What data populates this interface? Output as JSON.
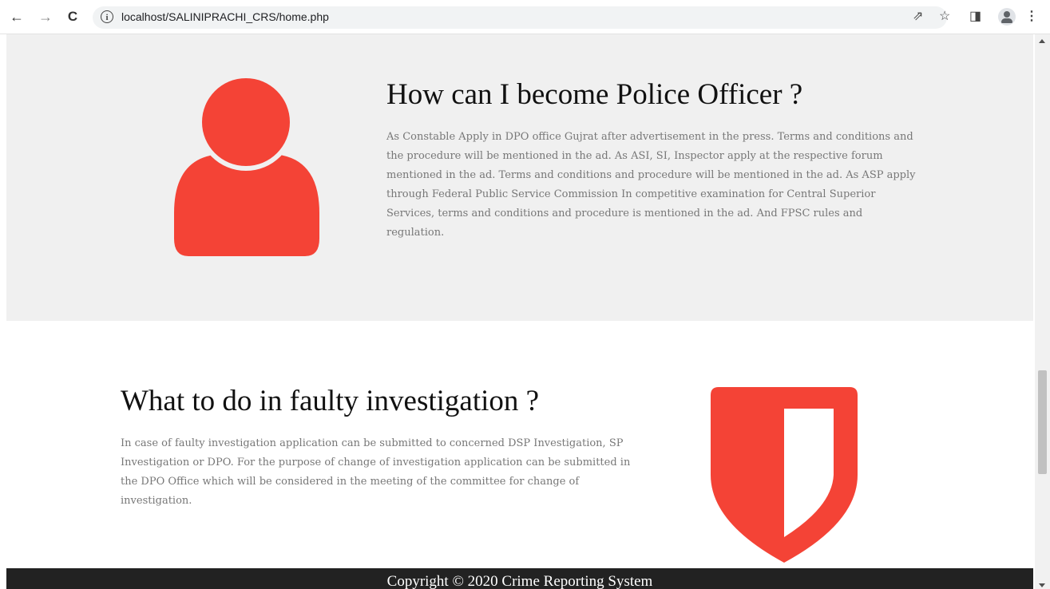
{
  "browser": {
    "url": "localhost/SALINIPRACHI_CRS/home.php",
    "back_icon": "←",
    "forward_icon": "→",
    "reload_icon": "C",
    "info_icon": "i",
    "share_icon": "⇗",
    "star_icon": "☆",
    "sidepanel_icon": "◨",
    "menu_icon": "⋮"
  },
  "section1": {
    "title": "How can I become Police Officer ?",
    "text": "As Constable Apply in DPO office Gujrat after advertisement in the press. Terms and conditions and the procedure will be mentioned in the ad. As ASI, SI, Inspector apply at the respective forum mentioned in the ad. Terms and conditions and procedure will be mentioned in the ad. As ASP apply through Federal Public Service Commission In competitive examination for Central Superior Services, terms and conditions and procedure is mentioned in the ad. And FPSC rules and regulation."
  },
  "section2": {
    "title": "What to do in faulty investigation ?",
    "text": "In case of faulty investigation application can be submitted to concerned DSP Investigation, SP Investigation or DPO. For the purpose of change of investigation application can be submitted in the DPO Office which will be considered in the meeting of the committee for change of investigation."
  },
  "footer": {
    "text": "Copyright © 2020 Crime Reporting System"
  },
  "colors": {
    "accent": "#f44336",
    "gray_section": "#f0f0f0",
    "footer_bg": "#222222"
  }
}
